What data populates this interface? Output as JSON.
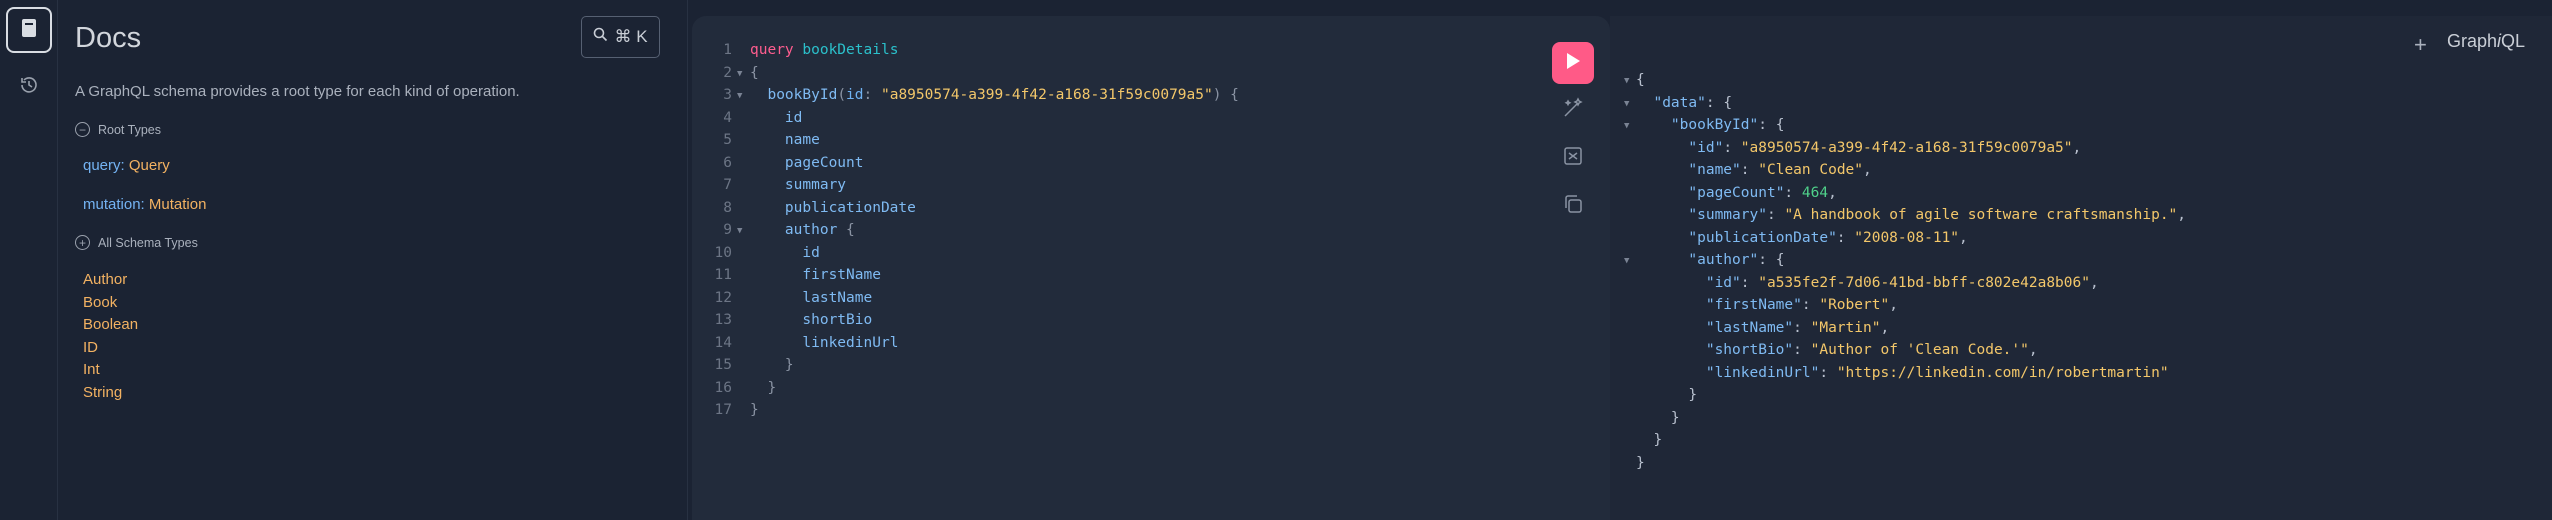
{
  "sidebar": {
    "items": [
      {
        "icon": "docs-book-icon",
        "active": true
      },
      {
        "icon": "history-icon",
        "active": false
      }
    ]
  },
  "docs": {
    "title": "Docs",
    "shortcut": "⌘ K",
    "description": "A GraphQL schema provides a root type for each kind of operation.",
    "root_types_label": "Root Types",
    "root_types": [
      {
        "operation": "query",
        "type": "Query"
      },
      {
        "operation": "mutation",
        "type": "Mutation"
      }
    ],
    "all_types_label": "All Schema Types",
    "schema_types": [
      "Author",
      "Book",
      "Boolean",
      "ID",
      "Int",
      "String"
    ]
  },
  "editor": {
    "lines": [
      {
        "n": "1",
        "fold": false,
        "tokens": [
          {
            "c": "tok-kw",
            "t": "query "
          },
          {
            "c": "tok-def",
            "t": "bookDetails"
          }
        ]
      },
      {
        "n": "2",
        "fold": true,
        "tokens": [
          {
            "c": "tok-punc",
            "t": "{"
          }
        ]
      },
      {
        "n": "3",
        "fold": true,
        "tokens": [
          {
            "c": "",
            "t": "  "
          },
          {
            "c": "tok-field",
            "t": "bookById"
          },
          {
            "c": "tok-punc",
            "t": "("
          },
          {
            "c": "tok-arg",
            "t": "id"
          },
          {
            "c": "tok-punc",
            "t": ": "
          },
          {
            "c": "tok-str",
            "t": "\"a8950574-a399-4f42-a168-31f59c0079a5\""
          },
          {
            "c": "tok-punc",
            "t": ") {"
          }
        ]
      },
      {
        "n": "4",
        "fold": false,
        "tokens": [
          {
            "c": "",
            "t": "    "
          },
          {
            "c": "tok-field",
            "t": "id"
          }
        ]
      },
      {
        "n": "5",
        "fold": false,
        "tokens": [
          {
            "c": "",
            "t": "    "
          },
          {
            "c": "tok-field",
            "t": "name"
          }
        ]
      },
      {
        "n": "6",
        "fold": false,
        "tokens": [
          {
            "c": "",
            "t": "    "
          },
          {
            "c": "tok-field",
            "t": "pageCount"
          }
        ]
      },
      {
        "n": "7",
        "fold": false,
        "tokens": [
          {
            "c": "",
            "t": "    "
          },
          {
            "c": "tok-field",
            "t": "summary"
          }
        ]
      },
      {
        "n": "8",
        "fold": false,
        "tokens": [
          {
            "c": "",
            "t": "    "
          },
          {
            "c": "tok-field",
            "t": "publicationDate"
          }
        ]
      },
      {
        "n": "9",
        "fold": true,
        "tokens": [
          {
            "c": "",
            "t": "    "
          },
          {
            "c": "tok-field",
            "t": "author"
          },
          {
            "c": "tok-punc",
            "t": " {"
          }
        ]
      },
      {
        "n": "10",
        "fold": false,
        "tokens": [
          {
            "c": "",
            "t": "      "
          },
          {
            "c": "tok-field",
            "t": "id"
          }
        ]
      },
      {
        "n": "11",
        "fold": false,
        "tokens": [
          {
            "c": "",
            "t": "      "
          },
          {
            "c": "tok-field",
            "t": "firstName"
          }
        ]
      },
      {
        "n": "12",
        "fold": false,
        "tokens": [
          {
            "c": "",
            "t": "      "
          },
          {
            "c": "tok-field",
            "t": "lastName"
          }
        ]
      },
      {
        "n": "13",
        "fold": false,
        "tokens": [
          {
            "c": "",
            "t": "      "
          },
          {
            "c": "tok-field",
            "t": "shortBio"
          }
        ]
      },
      {
        "n": "14",
        "fold": false,
        "tokens": [
          {
            "c": "",
            "t": "      "
          },
          {
            "c": "tok-field",
            "t": "linkedinUrl"
          }
        ]
      },
      {
        "n": "15",
        "fold": false,
        "tokens": [
          {
            "c": "",
            "t": "    "
          },
          {
            "c": "tok-punc",
            "t": "}"
          }
        ]
      },
      {
        "n": "16",
        "fold": false,
        "tokens": [
          {
            "c": "",
            "t": "  "
          },
          {
            "c": "tok-punc",
            "t": "}"
          }
        ]
      },
      {
        "n": "17",
        "fold": false,
        "tokens": [
          {
            "c": "tok-punc",
            "t": "}"
          }
        ]
      }
    ],
    "tools": [
      "prettify-icon",
      "merge-fragments-icon",
      "copy-icon"
    ]
  },
  "response": {
    "brand_prefix": "Graph",
    "brand_italic": "i",
    "brand_suffix": "QL",
    "plus": "+",
    "lines": [
      {
        "fold": true,
        "tokens": [
          {
            "c": "",
            "t": "{"
          }
        ]
      },
      {
        "fold": true,
        "tokens": [
          {
            "c": "",
            "t": "  "
          },
          {
            "c": "rkey",
            "t": "\"data\""
          },
          {
            "c": "",
            "t": ": {"
          }
        ]
      },
      {
        "fold": true,
        "tokens": [
          {
            "c": "",
            "t": "    "
          },
          {
            "c": "rkey",
            "t": "\"bookById\""
          },
          {
            "c": "",
            "t": ": {"
          }
        ]
      },
      {
        "fold": false,
        "tokens": [
          {
            "c": "",
            "t": "      "
          },
          {
            "c": "rkey",
            "t": "\"id\""
          },
          {
            "c": "",
            "t": ": "
          },
          {
            "c": "rstr",
            "t": "\"a8950574-a399-4f42-a168-31f59c0079a5\""
          },
          {
            "c": "",
            "t": ","
          }
        ]
      },
      {
        "fold": false,
        "tokens": [
          {
            "c": "",
            "t": "      "
          },
          {
            "c": "rkey",
            "t": "\"name\""
          },
          {
            "c": "",
            "t": ": "
          },
          {
            "c": "rstr",
            "t": "\"Clean Code\""
          },
          {
            "c": "",
            "t": ","
          }
        ]
      },
      {
        "fold": false,
        "tokens": [
          {
            "c": "",
            "t": "      "
          },
          {
            "c": "rkey",
            "t": "\"pageCount\""
          },
          {
            "c": "",
            "t": ": "
          },
          {
            "c": "rnum",
            "t": "464"
          },
          {
            "c": "",
            "t": ","
          }
        ]
      },
      {
        "fold": false,
        "tokens": [
          {
            "c": "",
            "t": "      "
          },
          {
            "c": "rkey",
            "t": "\"summary\""
          },
          {
            "c": "",
            "t": ": "
          },
          {
            "c": "rstr",
            "t": "\"A handbook of agile software craftsmanship.\""
          },
          {
            "c": "",
            "t": ","
          }
        ]
      },
      {
        "fold": false,
        "tokens": [
          {
            "c": "",
            "t": "      "
          },
          {
            "c": "rkey",
            "t": "\"publicationDate\""
          },
          {
            "c": "",
            "t": ": "
          },
          {
            "c": "rstr",
            "t": "\"2008-08-11\""
          },
          {
            "c": "",
            "t": ","
          }
        ]
      },
      {
        "fold": true,
        "tokens": [
          {
            "c": "",
            "t": "      "
          },
          {
            "c": "rkey",
            "t": "\"author\""
          },
          {
            "c": "",
            "t": ": {"
          }
        ]
      },
      {
        "fold": false,
        "tokens": [
          {
            "c": "",
            "t": "        "
          },
          {
            "c": "rkey",
            "t": "\"id\""
          },
          {
            "c": "",
            "t": ": "
          },
          {
            "c": "rstr",
            "t": "\"a535fe2f-7d06-41bd-bbff-c802e42a8b06\""
          },
          {
            "c": "",
            "t": ","
          }
        ]
      },
      {
        "fold": false,
        "tokens": [
          {
            "c": "",
            "t": "        "
          },
          {
            "c": "rkey",
            "t": "\"firstName\""
          },
          {
            "c": "",
            "t": ": "
          },
          {
            "c": "rstr",
            "t": "\"Robert\""
          },
          {
            "c": "",
            "t": ","
          }
        ]
      },
      {
        "fold": false,
        "tokens": [
          {
            "c": "",
            "t": "        "
          },
          {
            "c": "rkey",
            "t": "\"lastName\""
          },
          {
            "c": "",
            "t": ": "
          },
          {
            "c": "rstr",
            "t": "\"Martin\""
          },
          {
            "c": "",
            "t": ","
          }
        ]
      },
      {
        "fold": false,
        "tokens": [
          {
            "c": "",
            "t": "        "
          },
          {
            "c": "rkey",
            "t": "\"shortBio\""
          },
          {
            "c": "",
            "t": ": "
          },
          {
            "c": "rstr",
            "t": "\"Author of 'Clean Code.'\""
          },
          {
            "c": "",
            "t": ","
          }
        ]
      },
      {
        "fold": false,
        "tokens": [
          {
            "c": "",
            "t": "        "
          },
          {
            "c": "rkey",
            "t": "\"linkedinUrl\""
          },
          {
            "c": "",
            "t": ": "
          },
          {
            "c": "rstr",
            "t": "\"https://linkedin.com/in/robertmartin\""
          }
        ]
      },
      {
        "fold": false,
        "tokens": [
          {
            "c": "",
            "t": "      }"
          }
        ]
      },
      {
        "fold": false,
        "tokens": [
          {
            "c": "",
            "t": "    }"
          }
        ]
      },
      {
        "fold": false,
        "tokens": [
          {
            "c": "",
            "t": "  }"
          }
        ]
      },
      {
        "fold": false,
        "tokens": [
          {
            "c": "",
            "t": "}"
          }
        ]
      }
    ]
  }
}
